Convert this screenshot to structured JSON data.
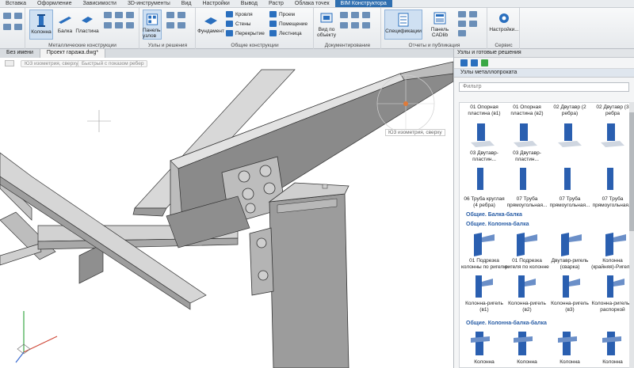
{
  "ribbon_tabs": [
    "Вставка",
    "Оформление",
    "Зависимости",
    "3D-инструменты",
    "Вид",
    "Настройки",
    "Вывод",
    "Растр",
    "Облака точек",
    "BIM Конструктора"
  ],
  "ribbon": {
    "metal": {
      "label": "Металлические конструкции",
      "kolonna": "Колонна",
      "balka": "Балка",
      "plastina": "Пластина"
    },
    "nodes": {
      "label": "Узлы и решения",
      "panel": "Панель узлов"
    },
    "general": {
      "label": "Общие конструкции",
      "fundament": "Фундамент",
      "krovlya": "Кровля",
      "steny": "Стены",
      "perekrytie": "Перекрытие",
      "proem": "Проем",
      "pomeshchenie": "Помещение",
      "lestnica": "Лестница"
    },
    "docs": {
      "label": "Документирование",
      "view": "Вид по объекту"
    },
    "reports": {
      "label": "Отчеты и публикация",
      "spec": "Спецификации",
      "cadlib": "Панель CADlib"
    },
    "service": {
      "label": "Сервис",
      "settings": "Настройки..."
    }
  },
  "doc_tabs": [
    "Без имени",
    "Проект гаража.dwg*"
  ],
  "viewport": {
    "view_label": "Ю3 изометрия, сверху",
    "style_label": "Быстрый с показом ребер",
    "compass_label": "Ю3 изометрия, сверху"
  },
  "panel": {
    "title": "Узлы и готовые решения",
    "subtitle": "Узлы металлопроката",
    "filter_placeholder": "Фильтр",
    "row1": [
      "01 Опорная пластина (в1)",
      "01 Опорная пластина (в2)",
      "02 Двутавр (2 ребра)",
      "02 Двутавр (3 ребра"
    ],
    "row2": [
      "03 Двутавр-пластин...",
      "03 Двутавр-пластин...",
      "",
      ""
    ],
    "row3": [
      "06 Труба круглая (4 ребра)",
      "07 Труба прямоугольная...",
      "07 Труба прямоугольная...",
      "07 Труба прямоугольная..."
    ],
    "sections": [
      "Общие. Балка-балка",
      "Общие. Колонна-балка",
      "Общие. Колонна-балка-балка"
    ],
    "row4": [
      "01 Подрезка колонны по ригелю",
      "01 Подрезка ригеля по колонне",
      "Двутавр-ригель (сварка)",
      "Колонна (крайняя)-Ригел..."
    ],
    "row5": [
      "Колонна-ригель (в1)",
      "Колонна-ригель (в2)",
      "Колонна-ригель (в3)",
      "Колонна-ригель с распоркой"
    ],
    "row6": [
      "Колонна",
      "Колонна",
      "Колонна",
      "Колонна"
    ]
  },
  "colors": {
    "accent": "#2f6fb0",
    "steel_blue": "#2a5fb0",
    "beam_gray": "#b8b8b8"
  }
}
